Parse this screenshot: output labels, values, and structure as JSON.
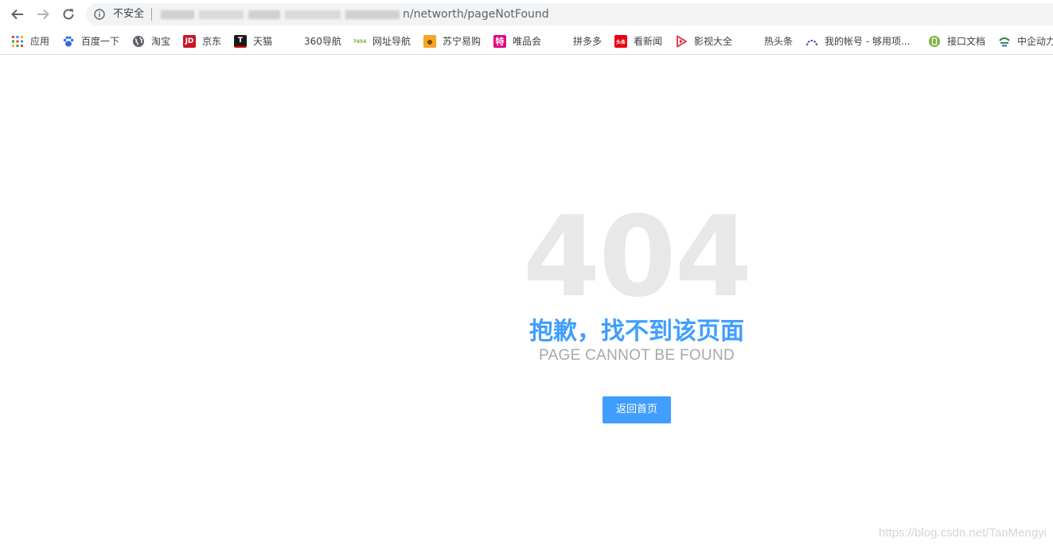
{
  "omnibox": {
    "security_text": "不安全",
    "url_visible_fragment": "n/networth/pageNotFound"
  },
  "bookmarks": [
    {
      "label": "应用",
      "icon": "apps-grid-icon"
    },
    {
      "label": "百度一下",
      "icon": "baidu-paw-icon"
    },
    {
      "label": "淘宝",
      "icon": "globe-icon"
    },
    {
      "label": "京东",
      "icon": "jd-logo-icon",
      "icon_text": "JD",
      "color": "#c81623"
    },
    {
      "label": "天猫",
      "icon": "tmall-logo-icon",
      "icon_text": "T",
      "color": "#1a1a1a"
    },
    {
      "label": "360导航",
      "icon": "none"
    },
    {
      "label": "网址导航",
      "icon": "7654-logo-icon",
      "icon_text": "7654",
      "color": "#6cb33e"
    },
    {
      "label": "苏宁易购",
      "icon": "suning-logo-icon",
      "icon_text": "●",
      "color": "#f5a623"
    },
    {
      "label": "唯品会",
      "icon": "vip-logo-icon",
      "icon_text": "特",
      "color": "#e4007f"
    },
    {
      "label": "拼多多",
      "icon": "none"
    },
    {
      "label": "看新闻",
      "icon": "kanxinwen-logo-icon",
      "icon_text": "头条",
      "color": "#e60012"
    },
    {
      "label": "影视大全",
      "icon": "play-logo-icon"
    },
    {
      "label": "热头条",
      "icon": "none"
    },
    {
      "label": "我的帐号 - 够用项...",
      "icon": "arc-logo-icon"
    },
    {
      "label": "接口文档",
      "icon": "green-circle-icon"
    },
    {
      "label": "中企动力",
      "icon": "cloud-logo-icon"
    }
  ],
  "main": {
    "code": "404",
    "title_cn": "抱歉，找不到该页面",
    "title_en": "PAGE CANNOT BE FOUND",
    "button_label": "返回首页"
  },
  "watermark": "https://blog.csdn.net/TanMengyi",
  "colors": {
    "accent": "#409eff",
    "code_text": "#e8e8e8",
    "subtitle_text": "#a4a9ad"
  }
}
